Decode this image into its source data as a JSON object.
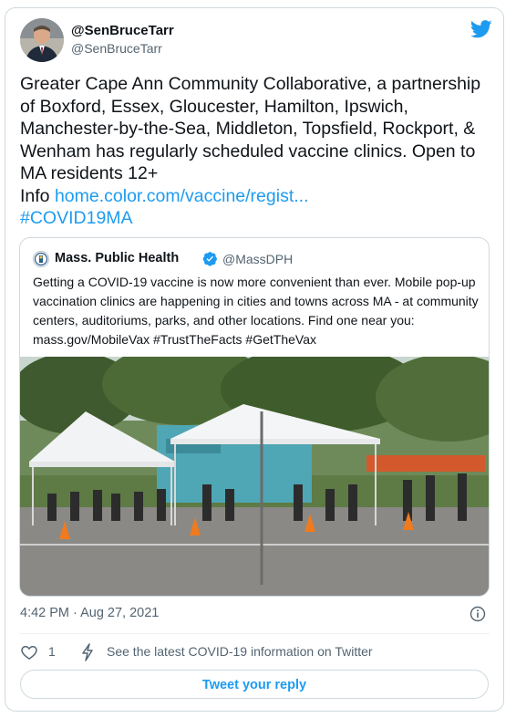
{
  "author": {
    "name": "@SenBruceTarr",
    "handle": "@SenBruceTarr",
    "avatar_icon": "profile-photo"
  },
  "tweet": {
    "text": "Greater Cape Ann Community Collaborative, a partnership of Boxford, Essex, Gloucester, Hamilton, Ipswich, Manchester-by-the-Sea, Middleton, Topsfield, Rockport, & Wenham has regularly scheduled vaccine clinics. Open to MA residents 12+",
    "info_prefix": "Info ",
    "link": "home.color.com/vaccine/regist...",
    "hashtag": "#COVID19MA"
  },
  "quoted_tweet": {
    "name": "Mass. Public Health",
    "handle": "@MassDPH",
    "text": "Getting a COVID-19 vaccine is now more convenient than ever. Mobile pop-up vaccination clinics are happening in cities and towns across MA - at community centers, auditoriums, parks, and other locations. Find one near you: mass.gov/MobileVax #TrustTheFacts #GetTheVax",
    "photo_description_icon": "vaccination-clinic-tents-photo"
  },
  "meta": {
    "timestamp": "4:42 PM · Aug 27, 2021"
  },
  "actions": {
    "like_count": "1",
    "covid_info": "See the latest COVID-19 information on Twitter"
  },
  "reply_button": {
    "label": "Tweet your reply"
  },
  "colors": {
    "accent": "#1d9bf0",
    "secondary_text": "#536471",
    "border": "#cfd9de"
  }
}
